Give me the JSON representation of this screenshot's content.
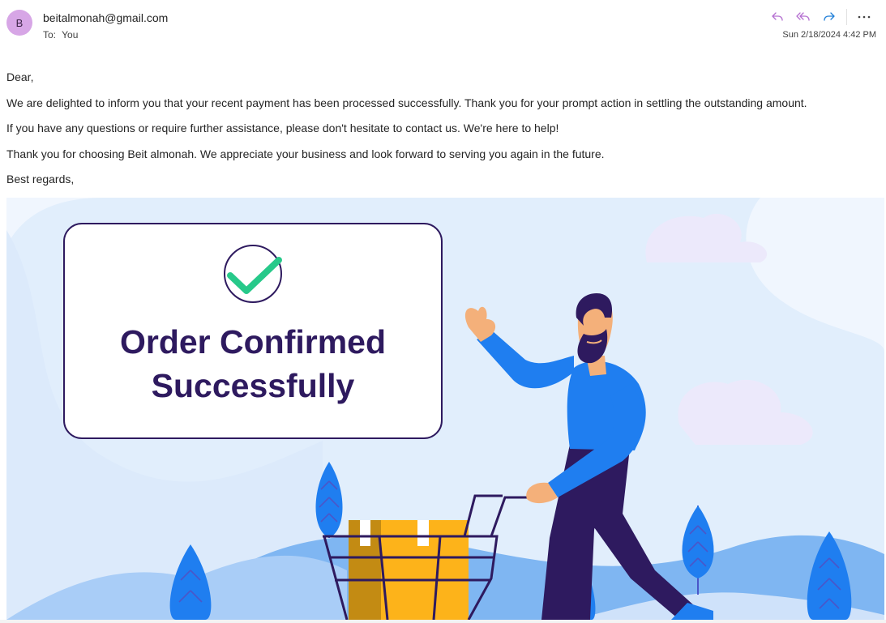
{
  "sender": {
    "avatar_initial": "B",
    "email": "beitalmonah@gmail.com",
    "to_label": "To:",
    "to_value": "You",
    "timestamp": "Sun 2/18/2024 4:42 PM"
  },
  "actions": {
    "icons": [
      "reply-icon",
      "reply-all-icon",
      "forward-icon",
      "more-options-icon"
    ]
  },
  "colors": {
    "accent_purple": "#b46fd0",
    "forward_blue": "#1e7ed8",
    "banner_bg": "#eaf2fd",
    "title_text": "#2e1a5f",
    "check_green": "#27c98a",
    "shirt_blue": "#1f7ef0",
    "box_yellow": "#fdb31a"
  },
  "body": {
    "greeting": "Dear,",
    "paragraph1": "We are delighted to inform you that your recent payment has been processed successfully. Thank you for your prompt action in settling the outstanding amount.",
    "paragraph2": "If you have any questions or require further assistance, please don't hesitate to contact us. We're here to help!",
    "paragraph3": "Thank you for choosing Beit almonah. We appreciate your business and look forward to serving you again in the future.",
    "closing": "Best regards,"
  },
  "banner": {
    "title_line1": "Order Confirmed",
    "title_line2": "Successfully"
  }
}
